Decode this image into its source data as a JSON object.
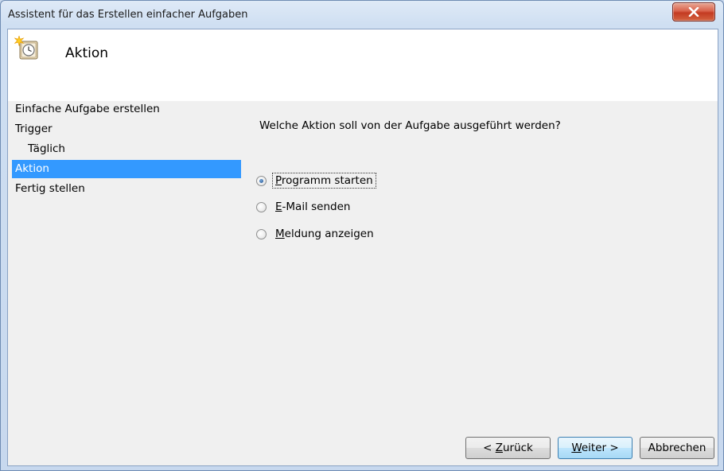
{
  "window": {
    "title": "Assistent für das Erstellen einfacher Aufgaben"
  },
  "header": {
    "icon": "scheduled-task-clock-icon",
    "title": "Aktion"
  },
  "nav": {
    "items": [
      {
        "label": "Einfache Aufgabe erstellen",
        "selected": false
      },
      {
        "label": "Trigger",
        "selected": false
      },
      {
        "label": "Täglich",
        "selected": false,
        "sub": true
      },
      {
        "label": "Aktion",
        "selected": true
      },
      {
        "label": "Fertig stellen",
        "selected": false
      }
    ]
  },
  "main": {
    "question": "Welche Aktion soll von der Aufgabe ausgeführt werden?",
    "options": [
      {
        "label": "Programm starten",
        "accel": "P",
        "rest": "rogramm starten",
        "checked": true
      },
      {
        "label": "E-Mail senden",
        "accel": "E",
        "rest": "-Mail senden",
        "checked": false
      },
      {
        "label": "Meldung anzeigen",
        "accel": "M",
        "rest": "eldung anzeigen",
        "checked": false
      }
    ]
  },
  "buttons": {
    "back": {
      "label": "< Zurück",
      "pre": "< ",
      "accel": "Z",
      "rest": "urück"
    },
    "next": {
      "label": "Weiter >",
      "accel": "W",
      "rest": "eiter >"
    },
    "cancel": {
      "label": "Abbrechen"
    }
  },
  "colors": {
    "selection": "#3399ff",
    "close_button": "#c33b22"
  }
}
